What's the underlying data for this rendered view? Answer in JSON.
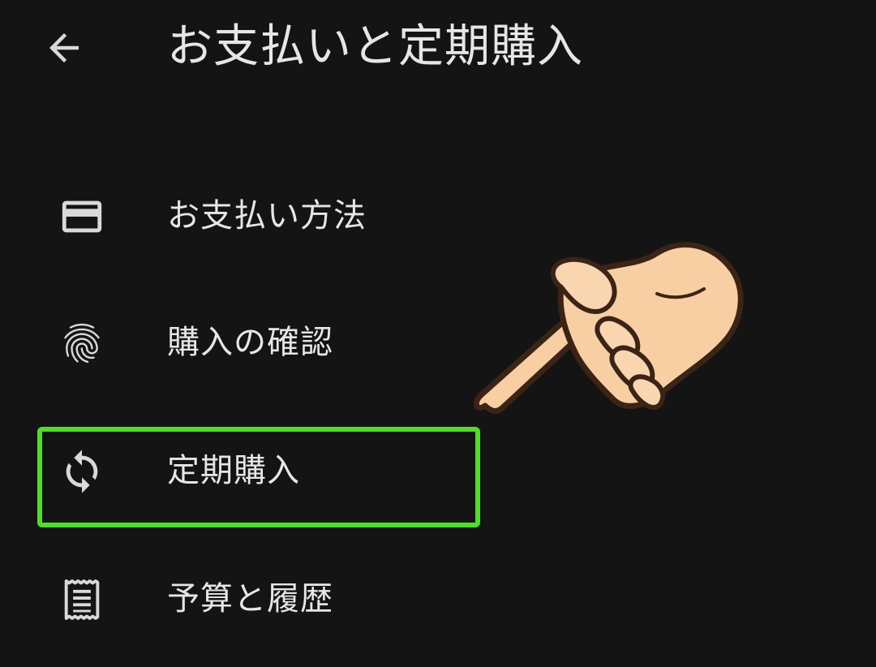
{
  "header": {
    "title": "お支払いと定期購入",
    "back_icon": "arrow-left-icon"
  },
  "menu": {
    "items": [
      {
        "label": "お支払い方法",
        "icon": "credit-card-icon"
      },
      {
        "label": "購入の確認",
        "icon": "fingerprint-icon"
      },
      {
        "label": "定期購入",
        "icon": "sync-icon",
        "highlighted": true
      },
      {
        "label": "予算と履歴",
        "icon": "receipt-icon"
      }
    ]
  },
  "annotation": {
    "highlight_color": "#4be11e",
    "pointer_icon": "pointing-hand-icon"
  },
  "colors": {
    "background": "#141414",
    "text": "#e6e6e6",
    "icon": "#d9d9d9"
  }
}
